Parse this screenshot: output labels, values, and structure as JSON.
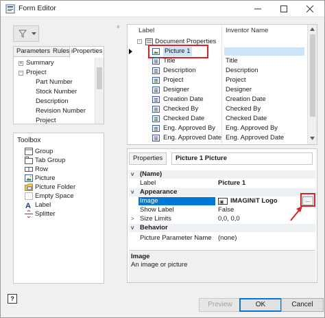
{
  "window": {
    "title": "Form Editor"
  },
  "left": {
    "tabs": [
      "Parameters",
      "Rules",
      "iProperties"
    ],
    "tree": [
      {
        "label": "Summary",
        "expander": "+"
      },
      {
        "label": "Project",
        "expander": "-"
      },
      {
        "label": "Part Number"
      },
      {
        "label": "Stock Number"
      },
      {
        "label": "Description"
      },
      {
        "label": "Revision Number"
      },
      {
        "label": "Project"
      }
    ],
    "toolbox_title": "Toolbox",
    "tools": [
      "Group",
      "Tab Group",
      "Row",
      "Picture",
      "Picture Folder",
      "Empty Space",
      "Label",
      "Splitter"
    ]
  },
  "tree": {
    "col_label": "Label",
    "col_name": "Inventor Name",
    "root": "Document Properties",
    "rows": [
      {
        "label": "Picture 1",
        "name": ""
      },
      {
        "label": "Title",
        "name": "Title"
      },
      {
        "label": "Description",
        "name": "Description"
      },
      {
        "label": "Project",
        "name": "Project"
      },
      {
        "label": "Designer",
        "name": "Designer"
      },
      {
        "label": "Creation Date",
        "name": "Creation Date"
      },
      {
        "label": "Checked By",
        "name": "Checked By"
      },
      {
        "label": "Checked Date",
        "name": "Checked Date"
      },
      {
        "label": "Eng. Approved By",
        "name": "Eng. Approved By"
      },
      {
        "label": "Eng. Approved Date",
        "name": "Eng. Approved Date"
      }
    ]
  },
  "props": {
    "tab_properties": "Properties",
    "tab_title": "Picture 1 Picture",
    "rows": [
      {
        "k": "(Name)",
        "v": "",
        "cat": true,
        "toggle": "v"
      },
      {
        "k": "Label",
        "v": "Picture 1"
      },
      {
        "k": "Appearance",
        "v": "",
        "cat": true,
        "toggle": "v"
      },
      {
        "k": "Image",
        "v": "IMAGINiT Logo"
      },
      {
        "k": "Show Label",
        "v": "False"
      },
      {
        "k": "Size Limits",
        "v": "0,0, 0,0",
        "toggle": ">"
      },
      {
        "k": "Behavior",
        "v": "",
        "cat": true,
        "toggle": "v"
      },
      {
        "k": "Picture Parameter Name",
        "v": "(none)"
      }
    ],
    "desc_title": "Image",
    "desc_text": "An image or picture",
    "ellipsis": "..."
  },
  "buttons": {
    "preview": "Preview",
    "ok": "OK",
    "cancel": "Cancel",
    "help": "?"
  },
  "colors": {
    "highlight": "#0078d7",
    "annotation": "#e02020",
    "row_selected": "#cce4f7"
  }
}
